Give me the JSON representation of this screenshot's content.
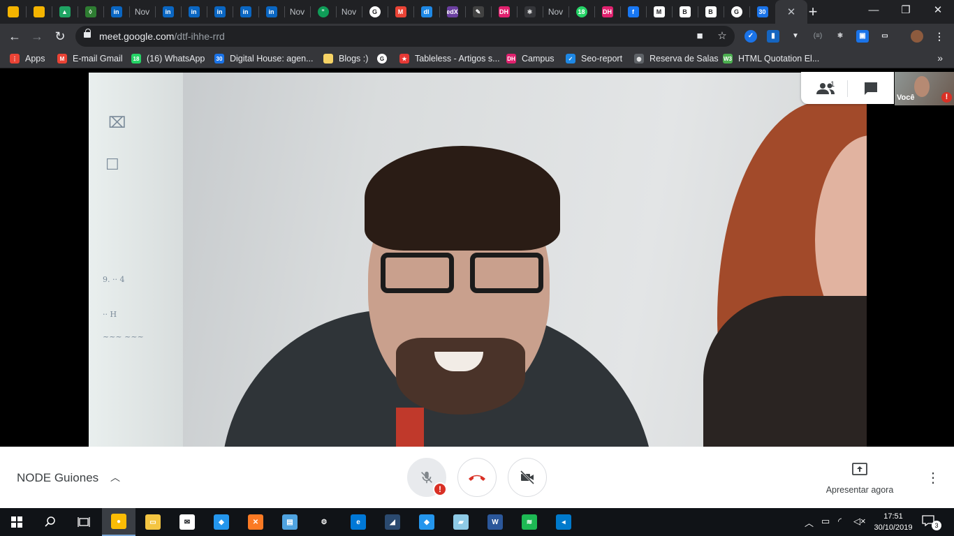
{
  "browser": {
    "tabs": [
      {
        "icon": "slides-icon",
        "color": "#f4b400",
        "glyph": ""
      },
      {
        "icon": "slides-icon",
        "color": "#f4b400",
        "glyph": ""
      },
      {
        "icon": "drive-icon",
        "color": "#1fa463",
        "glyph": "▲"
      },
      {
        "icon": "shield-icon",
        "color": "#2e7d32",
        "glyph": "◊"
      },
      {
        "icon": "linkedin-icon",
        "color": "#0a66c2",
        "glyph": "in"
      },
      {
        "icon": "text",
        "color": "",
        "glyph": "Nov"
      },
      {
        "icon": "linkedin-icon",
        "color": "#0a66c2",
        "glyph": "in"
      },
      {
        "icon": "linkedin-icon",
        "color": "#0a66c2",
        "glyph": "in"
      },
      {
        "icon": "linkedin-icon",
        "color": "#0a66c2",
        "glyph": "in"
      },
      {
        "icon": "linkedin-icon",
        "color": "#0a66c2",
        "glyph": "in"
      },
      {
        "icon": "linkedin-icon",
        "color": "#0a66c2",
        "glyph": "in"
      },
      {
        "icon": "text",
        "color": "",
        "glyph": "Nov"
      },
      {
        "icon": "hangouts-icon",
        "color": "#0f9d58",
        "glyph": "”"
      },
      {
        "icon": "text",
        "color": "",
        "glyph": "Nov"
      },
      {
        "icon": "google-icon",
        "color": "#ffffff",
        "glyph": "G"
      },
      {
        "icon": "gmail-icon",
        "color": "#ea4335",
        "glyph": "M"
      },
      {
        "icon": "analytics-icon",
        "color": "#1e88e5",
        "glyph": "dl"
      },
      {
        "icon": "edx-icon",
        "color": "#6b3fa0",
        "glyph": "edX"
      },
      {
        "icon": "notes-icon",
        "color": "#424242",
        "glyph": "✎"
      },
      {
        "icon": "dh-icon",
        "color": "#e0216e",
        "glyph": "DH"
      },
      {
        "icon": "react-icon",
        "color": "#35363a",
        "glyph": "⚛"
      },
      {
        "icon": "text",
        "color": "",
        "glyph": "Nov"
      },
      {
        "icon": "whatsapp-icon",
        "color": "#25d366",
        "glyph": "18"
      },
      {
        "icon": "dh-icon",
        "color": "#e0216e",
        "glyph": "DH"
      },
      {
        "icon": "facebook-icon",
        "color": "#1877f2",
        "glyph": "f"
      },
      {
        "icon": "medium-icon",
        "color": "#ffffff",
        "glyph": "M"
      },
      {
        "icon": "bootstrap-icon",
        "color": "#ffffff",
        "glyph": "B"
      },
      {
        "icon": "bootstrap-icon",
        "color": "#ffffff",
        "glyph": "B"
      },
      {
        "icon": "google-icon",
        "color": "#ffffff",
        "glyph": "G"
      },
      {
        "icon": "calendar-icon",
        "color": "#1a73e8",
        "glyph": "30"
      }
    ],
    "url_host": "meet.google.com",
    "url_path": "/dtf-ihhe-rrd",
    "bookmarks": [
      {
        "label": "Apps",
        "icon": "apps-grid-icon",
        "color": "#ea4335",
        "glyph": "⋮"
      },
      {
        "label": "E-mail Gmail",
        "icon": "gmail-icon",
        "color": "#ea4335",
        "glyph": "M"
      },
      {
        "label": "(16) WhatsApp",
        "icon": "whatsapp-icon",
        "color": "#25d366",
        "glyph": "18"
      },
      {
        "label": "Digital House: agen...",
        "icon": "calendar-icon",
        "color": "#1a73e8",
        "glyph": "30"
      },
      {
        "label": "Blogs :)",
        "icon": "folder-icon",
        "color": "#f6d365",
        "glyph": ""
      },
      {
        "label": "",
        "icon": "google-icon",
        "color": "#ffffff",
        "glyph": "G"
      },
      {
        "label": "Tableless - Artigos s...",
        "icon": "tableless-icon",
        "color": "#e53935",
        "glyph": "★"
      },
      {
        "label": "Campus",
        "icon": "dh-icon",
        "color": "#e0216e",
        "glyph": "DH"
      },
      {
        "label": "Seo-report",
        "icon": "seo-icon",
        "color": "#1e88e5",
        "glyph": "✓"
      },
      {
        "label": "Reserva de Salas",
        "icon": "globe-icon",
        "color": "#5f6368",
        "glyph": "◍"
      },
      {
        "label": "HTML Quotation El...",
        "icon": "w3-icon",
        "color": "#4caf50",
        "glyph": "W3"
      }
    ]
  },
  "meet": {
    "people_count": "1",
    "self_label": "Você",
    "self_alert": "!",
    "meeting_name": "NODE Guiones",
    "present_label": "Apresentar agora",
    "mic_alert": "!"
  },
  "taskbar": {
    "time": "17:51",
    "date": "30/10/2019",
    "notification_count": "3",
    "apps": [
      {
        "icon": "chrome-icon",
        "color": "#fbbc05",
        "glyph": "●",
        "active": true
      },
      {
        "icon": "file-explorer-icon",
        "color": "#f4c542",
        "glyph": "▭",
        "active": false
      },
      {
        "icon": "mail-icon",
        "color": "#ffffff",
        "glyph": "✉",
        "active": false
      },
      {
        "icon": "docker-icon",
        "color": "#2496ed",
        "glyph": "◆",
        "active": false
      },
      {
        "icon": "xampp-icon",
        "color": "#fb7a24",
        "glyph": "✕",
        "active": false
      },
      {
        "icon": "remote-icon",
        "color": "#4fa3e0",
        "glyph": "▤",
        "active": false
      },
      {
        "icon": "settings-icon",
        "color": "#101317",
        "glyph": "⚙",
        "active": false
      },
      {
        "icon": "edge-icon",
        "color": "#0078d7",
        "glyph": "e",
        "active": false
      },
      {
        "icon": "mysql-icon",
        "color": "#2b4a6f",
        "glyph": "◢",
        "active": false
      },
      {
        "icon": "docker-icon",
        "color": "#2496ed",
        "glyph": "◆",
        "active": false
      },
      {
        "icon": "notepad-icon",
        "color": "#8ecae6",
        "glyph": "▰",
        "active": false
      },
      {
        "icon": "word-icon",
        "color": "#2b579a",
        "glyph": "W",
        "active": false
      },
      {
        "icon": "spotify-icon",
        "color": "#1db954",
        "glyph": "≋",
        "active": false
      },
      {
        "icon": "vscode-icon",
        "color": "#007acc",
        "glyph": "◂",
        "active": false
      }
    ]
  }
}
